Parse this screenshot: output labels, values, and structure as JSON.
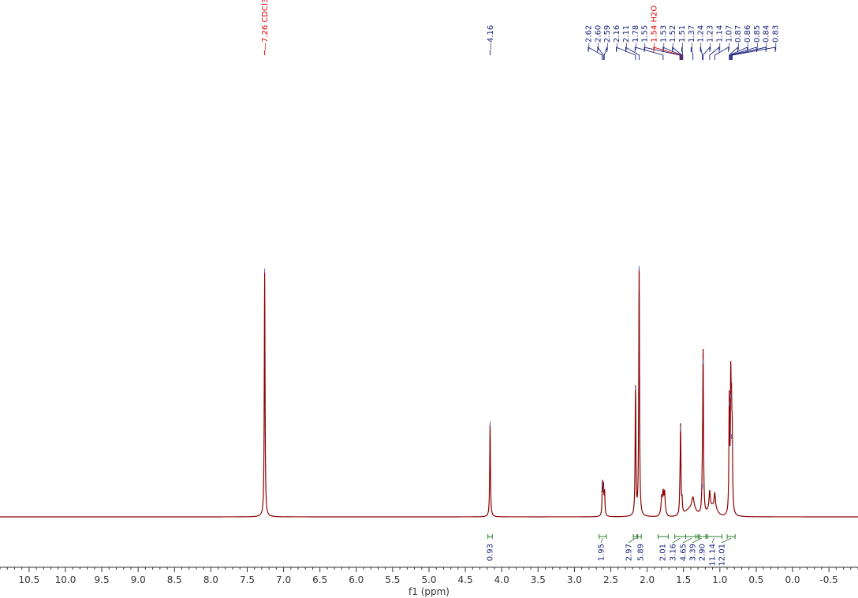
{
  "chart_data": {
    "type": "line",
    "xlabel": "f1 (ppm)",
    "xlim": [
      10.9,
      -0.9
    ],
    "x_ticks": [
      "10.5",
      "10.0",
      "9.5",
      "9.0",
      "8.5",
      "8.0",
      "7.5",
      "7.0",
      "6.5",
      "6.0",
      "5.5",
      "5.0",
      "4.5",
      "4.0",
      "3.5",
      "3.0",
      "2.5",
      "2.0",
      "1.5",
      "1.0",
      "0.5",
      "0.0",
      "-0.5"
    ],
    "colors": {
      "spectrum": "#8b0000",
      "peak_label": "#1a237e",
      "solvent_label": "#e00000",
      "integral": "#2e7d32",
      "axis": "#333333"
    },
    "peaks": [
      {
        "ppm": 7.26,
        "height": 0.985,
        "width": 0.006
      },
      {
        "ppm": 4.16,
        "height": 0.37,
        "width": 0.006
      },
      {
        "ppm": 2.615,
        "height": 0.13,
        "width": 0.006
      },
      {
        "ppm": 2.6,
        "height": 0.11,
        "width": 0.006
      },
      {
        "ppm": 2.585,
        "height": 0.09,
        "width": 0.006
      },
      {
        "ppm": 2.16,
        "height": 0.515,
        "width": 0.006
      },
      {
        "ppm": 2.11,
        "height": 0.995,
        "width": 0.006
      },
      {
        "ppm": 1.8,
        "height": 0.05,
        "width": 0.008
      },
      {
        "ppm": 1.78,
        "height": 0.06,
        "width": 0.008
      },
      {
        "ppm": 1.76,
        "height": 0.07,
        "width": 0.008
      },
      {
        "ppm": 1.55,
        "height": 0.06,
        "width": 0.006
      },
      {
        "ppm": 1.54,
        "height": 0.35,
        "width": 0.006
      },
      {
        "ppm": 1.52,
        "height": 0.05,
        "width": 0.006
      },
      {
        "ppm": 1.37,
        "height": 0.05,
        "width": 0.02
      },
      {
        "ppm": 1.24,
        "height": 0.12,
        "width": 0.008
      },
      {
        "ppm": 1.23,
        "height": 0.62,
        "width": 0.006
      },
      {
        "ppm": 1.14,
        "height": 0.07,
        "width": 0.01
      },
      {
        "ppm": 1.07,
        "height": 0.06,
        "width": 0.01
      },
      {
        "ppm": 0.87,
        "height": 0.45,
        "width": 0.006
      },
      {
        "ppm": 0.85,
        "height": 0.48,
        "width": 0.006
      },
      {
        "ppm": 0.84,
        "height": 0.32,
        "width": 0.006
      },
      {
        "ppm": 0.83,
        "height": 0.28,
        "width": 0.006
      }
    ],
    "peak_labels": [
      {
        "text": "7.26 CDCl3",
        "ppm": 7.26,
        "group": "solvent"
      },
      {
        "text": "4.16",
        "ppm": 4.16,
        "group": "peak"
      },
      {
        "text": "2.62",
        "ppm": 2.62,
        "group": "peak"
      },
      {
        "text": "2.60",
        "ppm": 2.6,
        "group": "peak"
      },
      {
        "text": "2.59",
        "ppm": 2.59,
        "group": "peak"
      },
      {
        "text": "2.16",
        "ppm": 2.16,
        "group": "peak"
      },
      {
        "text": "2.11",
        "ppm": 2.11,
        "group": "peak"
      },
      {
        "text": "1.78",
        "ppm": 1.78,
        "group": "peak"
      },
      {
        "text": "1.55",
        "ppm": 1.55,
        "group": "peak"
      },
      {
        "text": "1.54 H2O",
        "ppm": 1.54,
        "group": "solvent"
      },
      {
        "text": "1.53",
        "ppm": 1.53,
        "group": "peak"
      },
      {
        "text": "1.52",
        "ppm": 1.52,
        "group": "peak"
      },
      {
        "text": "1.51",
        "ppm": 1.51,
        "group": "peak"
      },
      {
        "text": "1.37",
        "ppm": 1.37,
        "group": "peak"
      },
      {
        "text": "1.24",
        "ppm": 1.24,
        "group": "peak"
      },
      {
        "text": "1.23",
        "ppm": 1.23,
        "group": "peak"
      },
      {
        "text": "1.14",
        "ppm": 1.14,
        "group": "peak"
      },
      {
        "text": "1.07",
        "ppm": 1.07,
        "group": "peak"
      },
      {
        "text": "0.87",
        "ppm": 0.87,
        "group": "peak"
      },
      {
        "text": "0.86",
        "ppm": 0.86,
        "group": "peak"
      },
      {
        "text": "0.85",
        "ppm": 0.85,
        "group": "peak"
      },
      {
        "text": "0.84",
        "ppm": 0.84,
        "group": "peak"
      },
      {
        "text": "0.83",
        "ppm": 0.83,
        "group": "peak"
      }
    ],
    "integrals": [
      {
        "value": "0.93",
        "from": 4.19,
        "to": 4.13
      },
      {
        "value": "1.95",
        "from": 2.66,
        "to": 2.56
      },
      {
        "value": "2.97",
        "from": 2.19,
        "to": 2.13
      },
      {
        "value": "5.89",
        "from": 2.14,
        "to": 2.08
      },
      {
        "value": "2.01",
        "from": 1.85,
        "to": 1.71
      },
      {
        "value": "3.16",
        "from": 1.62,
        "to": 1.47
      },
      {
        "value": "4.65",
        "from": 1.47,
        "to": 1.3
      },
      {
        "value": "3.39",
        "from": 1.33,
        "to": 1.17
      },
      {
        "value": "2.90",
        "from": 1.28,
        "to": 1.19
      },
      {
        "value": "11.14",
        "from": 1.19,
        "to": 0.97
      },
      {
        "value": "12.01",
        "from": 0.9,
        "to": 0.79
      }
    ]
  }
}
